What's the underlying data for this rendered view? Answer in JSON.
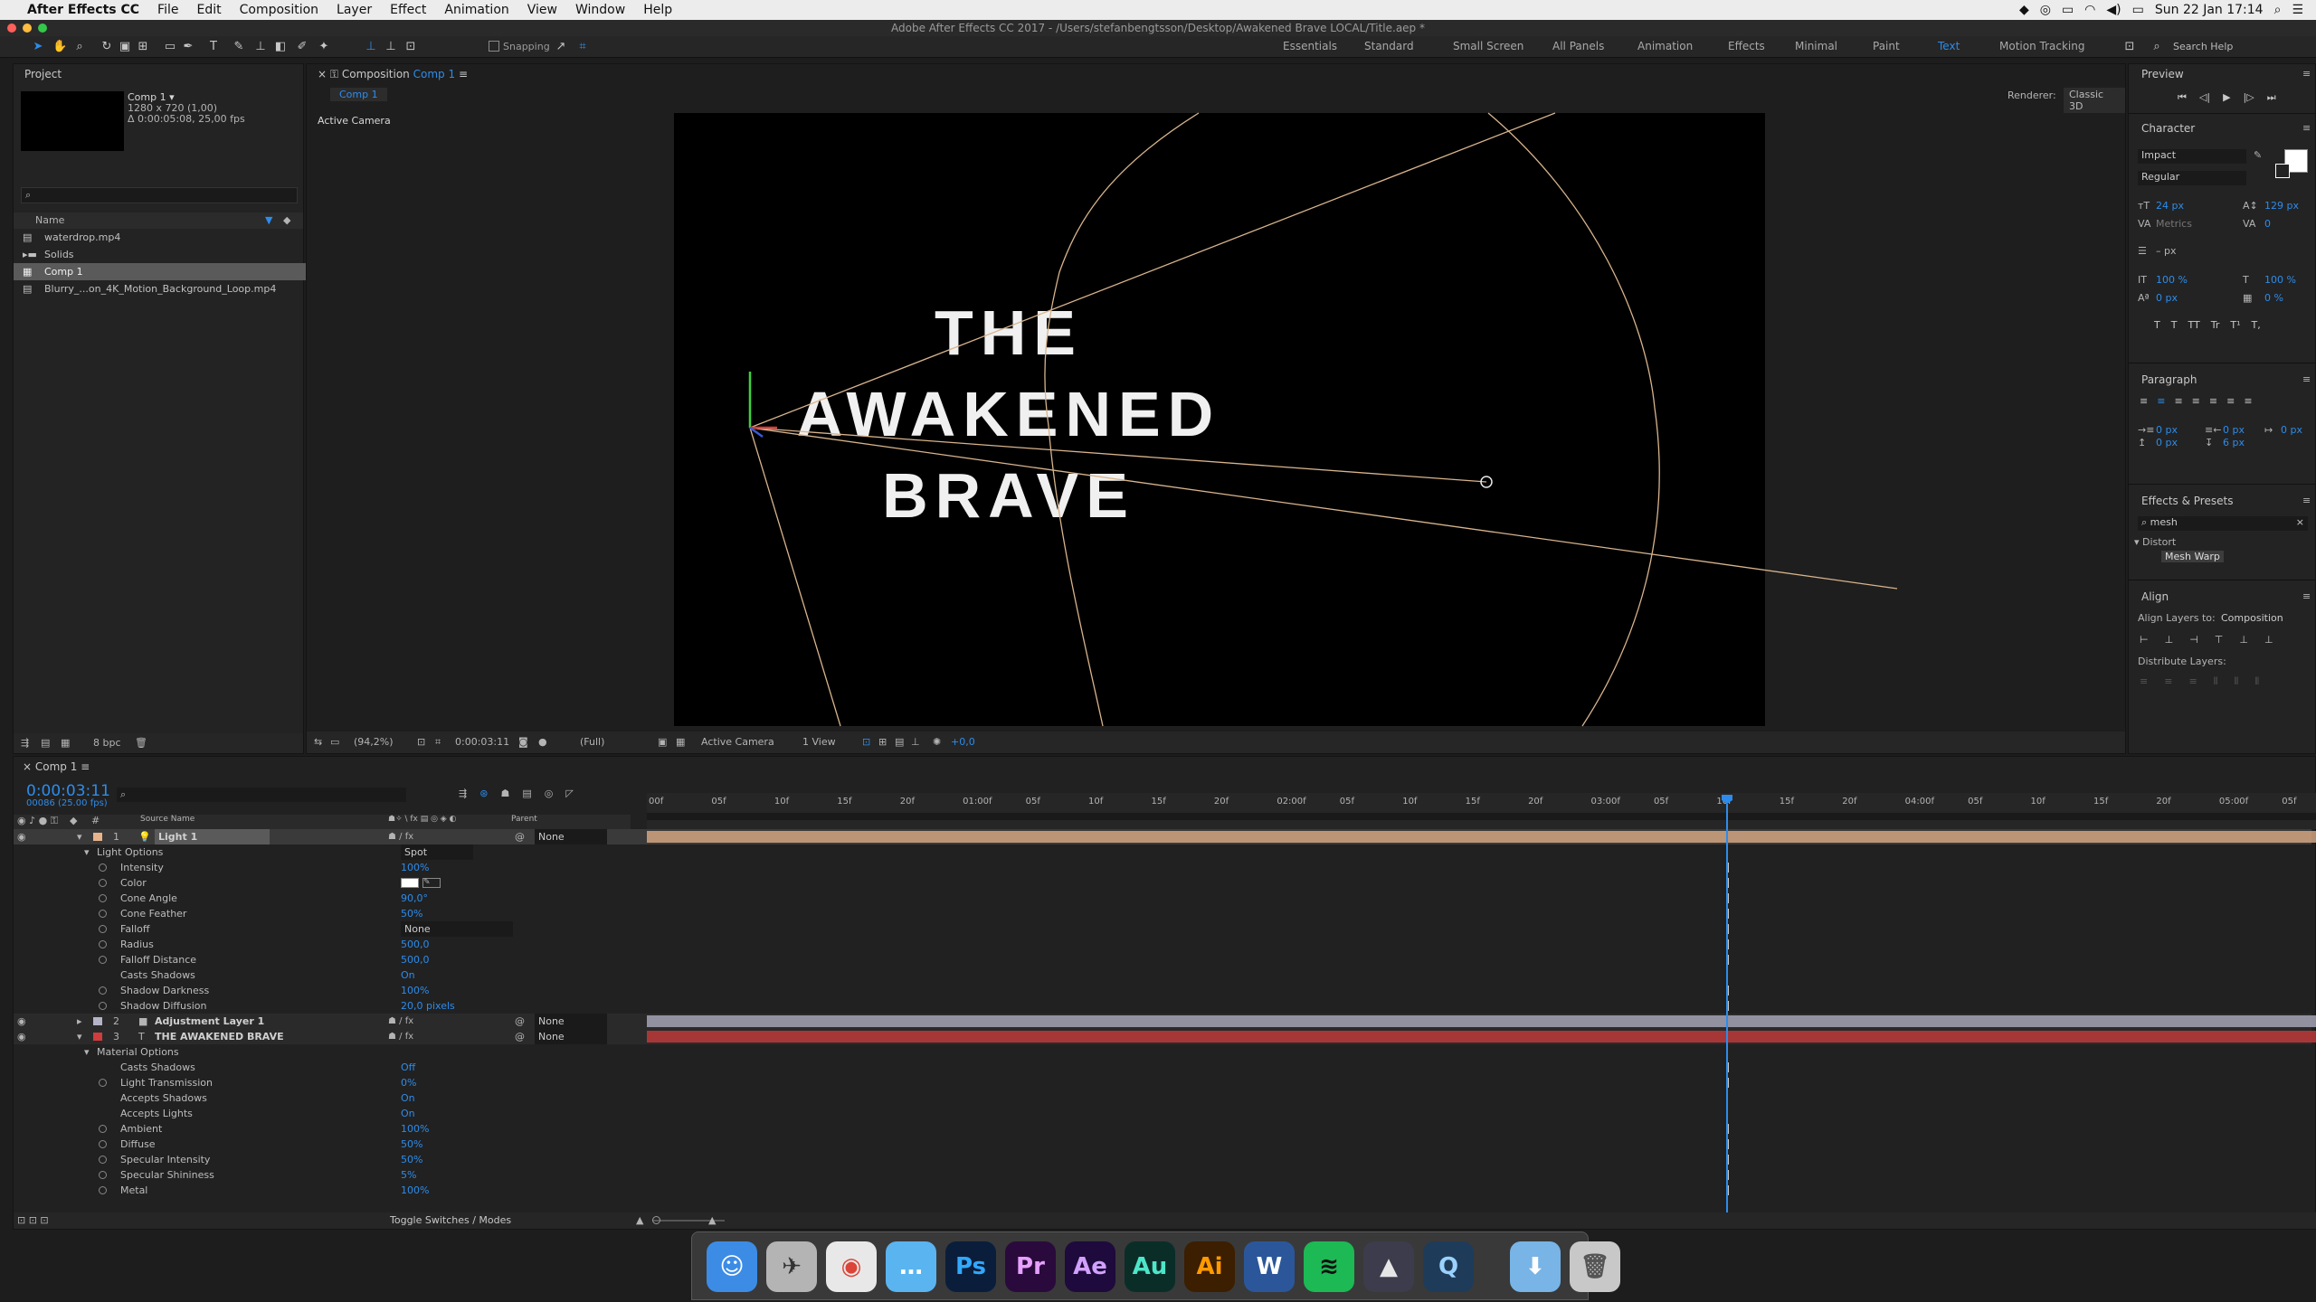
{
  "menubar": {
    "apple": "",
    "app_name": "After Effects CC",
    "items": [
      "File",
      "Edit",
      "Composition",
      "Layer",
      "Effect",
      "Animation",
      "View",
      "Window",
      "Help"
    ],
    "clock": "Sun 22 Jan  17:14"
  },
  "window": {
    "title": "Adobe After Effects CC 2017 - /Users/stefanbengtsson/Desktop/Awakened Brave LOCAL/Title.aep *"
  },
  "toolbar": {
    "snapping_label": "Snapping",
    "workspaces": [
      "Essentials",
      "Standard",
      "Small Screen",
      "All Panels",
      "Animation",
      "Effects",
      "Minimal",
      "Paint",
      "Text",
      "Motion Tracking"
    ],
    "active_workspace": "Text",
    "search_placeholder": "Search Help"
  },
  "project": {
    "tab": "Project",
    "comp_name": "Comp 1 ▾",
    "comp_size": "1280 x 720 (1,00)",
    "comp_duration": "Δ 0:00:05:08, 25,00 fps",
    "col_name": "Name",
    "items": [
      {
        "name": "waterdrop.mp4",
        "icon": "video-file-icon",
        "selected": false
      },
      {
        "name": "Solids",
        "icon": "folder-icon",
        "selected": false
      },
      {
        "name": "Comp 1",
        "icon": "composition-icon",
        "selected": true
      },
      {
        "name": "Blurry_...on_4K_Motion_Background_Loop.mp4",
        "icon": "video-file-icon",
        "selected": false
      }
    ],
    "bpc": "8 bpc"
  },
  "composition": {
    "panel_label": "Composition",
    "comp_tab": "Comp 1",
    "sub_tab": "Comp 1",
    "renderer_label": "Renderer:",
    "renderer_value": "Classic 3D",
    "camera_label": "Active Camera",
    "title_lines": [
      "THE",
      "AWAKENED",
      "BRAVE"
    ],
    "footer": {
      "zoom": "(94,2%)",
      "timecode": "0:00:03:11",
      "resolution": "(Full)",
      "view_camera": "Active Camera",
      "views": "1 View",
      "exposure": "+0,0"
    }
  },
  "preview": {
    "title": "Preview"
  },
  "character": {
    "title": "Character",
    "font": "Impact",
    "style": "Regular",
    "size": "24 px",
    "leading": "129 px",
    "kerning": "Metrics",
    "tracking": "0",
    "stroke": "– px",
    "vscale": "100 %",
    "hscale": "100 %",
    "baseline": "0 px",
    "tsume": "0 %",
    "style_buttons": [
      "T",
      "T",
      "TT",
      "Tr",
      "T¹",
      "T,"
    ]
  },
  "paragraph": {
    "title": "Paragraph",
    "indent_left": "0 px",
    "indent_right": "0 px",
    "indent_first": "0 px",
    "space_before": "0 px",
    "space_after": "6 px"
  },
  "effects": {
    "title": "Effects & Presets",
    "search_value": "mesh",
    "category": "Distort",
    "result": "Mesh Warp"
  },
  "align": {
    "title": "Align",
    "align_to_label": "Align Layers to:",
    "align_to_value": "Composition",
    "distribute_label": "Distribute Layers:"
  },
  "timeline": {
    "tab": "Comp 1",
    "timecode": "0:00:03:11",
    "frames": "00086 (25.00 fps)",
    "col_source": "Source Name",
    "col_parent": "Parent",
    "ruler": [
      "00f",
      "05f",
      "10f",
      "15f",
      "20f",
      "01:00f",
      "05f",
      "10f",
      "15f",
      "20f",
      "02:00f",
      "05f",
      "10f",
      "15f",
      "20f",
      "03:00f",
      "05f",
      "10f",
      "15f",
      "20f",
      "04:00f",
      "05f",
      "10f",
      "15f",
      "20f",
      "05:00f",
      "05f"
    ],
    "toggle_label": "Toggle Switches / Modes",
    "rows": [
      {
        "kind": "layer",
        "num": "1",
        "name": "Light 1",
        "color": "#e8b48c",
        "parent": "None",
        "selected": true,
        "switch": "light"
      },
      {
        "kind": "group",
        "name": "Light Options",
        "value": "Spot",
        "dropdown": true
      },
      {
        "kind": "prop",
        "name": "Intensity",
        "value": "100%",
        "kf": true
      },
      {
        "kind": "prop",
        "name": "Color",
        "value": "",
        "swatch": true,
        "kf": true
      },
      {
        "kind": "prop",
        "name": "Cone Angle",
        "value": "90,0°",
        "kf": true
      },
      {
        "kind": "prop",
        "name": "Cone Feather",
        "value": "50%",
        "kf": true
      },
      {
        "kind": "prop",
        "name": "Falloff",
        "value": "None",
        "dropdown": true,
        "kf": true
      },
      {
        "kind": "prop",
        "name": "Radius",
        "value": "500,0",
        "kf": true
      },
      {
        "kind": "prop",
        "name": "Falloff Distance",
        "value": "500,0",
        "kf": true
      },
      {
        "kind": "prop",
        "name": "Casts Shadows",
        "value": "On",
        "nostop": true
      },
      {
        "kind": "prop",
        "name": "Shadow Darkness",
        "value": "100%",
        "kf": true
      },
      {
        "kind": "prop",
        "name": "Shadow Diffusion",
        "value": "20,0 pixels",
        "kf": true
      },
      {
        "kind": "layer",
        "num": "2",
        "name": "Adjustment Layer 1",
        "color": "#b4b4c8",
        "parent": "None",
        "switch": "adjustment"
      },
      {
        "kind": "layer",
        "num": "3",
        "name": "THE AWAKENED BRAVE",
        "color": "#d23c3c",
        "parent": "None",
        "switch": "text"
      },
      {
        "kind": "group",
        "name": "Material Options",
        "value": ""
      },
      {
        "kind": "prop",
        "name": "Casts Shadows",
        "value": "Off",
        "nostop": true,
        "kf": true
      },
      {
        "kind": "prop",
        "name": "Light Transmission",
        "value": "0%",
        "kf": true
      },
      {
        "kind": "prop",
        "name": "Accepts Shadows",
        "value": "On",
        "nostop": true
      },
      {
        "kind": "prop",
        "name": "Accepts Lights",
        "value": "On",
        "nostop": true
      },
      {
        "kind": "prop",
        "name": "Ambient",
        "value": "100%",
        "kf": true
      },
      {
        "kind": "prop",
        "name": "Diffuse",
        "value": "50%",
        "kf": true
      },
      {
        "kind": "prop",
        "name": "Specular Intensity",
        "value": "50%",
        "kf": true
      },
      {
        "kind": "prop",
        "name": "Specular Shininess",
        "value": "5%",
        "kf": true
      },
      {
        "kind": "prop",
        "name": "Metal",
        "value": "100%",
        "kf": true
      }
    ]
  },
  "dock": {
    "apps": [
      {
        "name": "finder-icon",
        "glyph": "☺",
        "bg": "#3c8ce6",
        "fg": "#ffffff"
      },
      {
        "name": "launchpad-icon",
        "glyph": "✈",
        "bg": "#b4b4b4",
        "fg": "#333333"
      },
      {
        "name": "chrome-icon",
        "glyph": "◉",
        "bg": "#e8e8e8",
        "fg": "#db4437"
      },
      {
        "name": "messages-icon",
        "glyph": "…",
        "bg": "#5ab4f0",
        "fg": "#ffffff"
      },
      {
        "name": "photoshop-icon",
        "glyph": "Ps",
        "bg": "#0a1e3c",
        "fg": "#31a8ff"
      },
      {
        "name": "premiere-icon",
        "glyph": "Pr",
        "bg": "#2a0a3c",
        "fg": "#e6a0ff"
      },
      {
        "name": "after-effects-icon",
        "glyph": "Ae",
        "bg": "#1e0a3c",
        "fg": "#d2a0ff"
      },
      {
        "name": "audition-icon",
        "glyph": "Au",
        "bg": "#0a2d28",
        "fg": "#4de6c8"
      },
      {
        "name": "illustrator-icon",
        "glyph": "Ai",
        "bg": "#3c1e00",
        "fg": "#ff9a00"
      },
      {
        "name": "word-icon",
        "glyph": "W",
        "bg": "#2b579a",
        "fg": "#ffffff"
      },
      {
        "name": "spotify-icon",
        "glyph": "≋",
        "bg": "#1db954",
        "fg": "#111111"
      },
      {
        "name": "davinci-icon",
        "glyph": "▲",
        "bg": "#3c3c4c",
        "fg": "#e6e6e6"
      },
      {
        "name": "quicktime-icon",
        "glyph": "Q",
        "bg": "#1e3c5a",
        "fg": "#9ad2ff"
      },
      {
        "name": "downloads-icon",
        "glyph": "⬇",
        "bg": "#78b4e6",
        "fg": "#ffffff"
      },
      {
        "name": "trash-icon",
        "glyph": "🗑",
        "bg": "#c8c8c8",
        "fg": "#555555"
      }
    ]
  }
}
